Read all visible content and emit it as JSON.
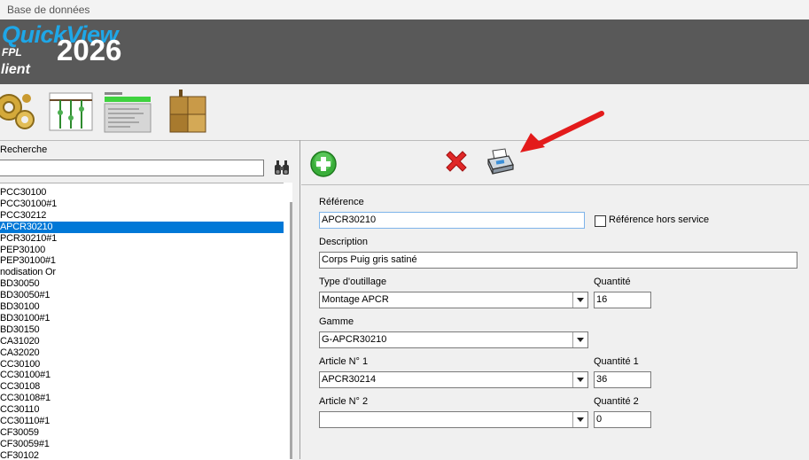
{
  "window": {
    "title": "Base de données"
  },
  "banner": {
    "brand": "QuickView",
    "sub": "FPL",
    "year": "2026",
    "client": "lient"
  },
  "toolbar": {
    "icons": [
      "gears-icon",
      "plants-icon",
      "program-list-icon",
      "boxes-icon"
    ]
  },
  "search": {
    "label": "Recherche",
    "value": ""
  },
  "references": [
    "PCC30100",
    "PCC30100#1",
    "PCC30212",
    "APCR30210",
    "PCR30210#1",
    "PEP30100",
    "PEP30100#1",
    "nodisation Or",
    "BD30050",
    "BD30050#1",
    "BD30100",
    "BD30100#1",
    "BD30150",
    "CA31020",
    "CA32020",
    "CC30100",
    "CC30100#1",
    "CC30108",
    "CC30108#1",
    "CC30110",
    "CC30110#1",
    "CF30059",
    "CF30059#1",
    "CF30102"
  ],
  "selected_reference": "APCR30210",
  "form": {
    "reference_label": "Référence",
    "reference_value": "APCR30210",
    "out_of_service_label": "Référence hors service",
    "out_of_service_checked": false,
    "description_label": "Description",
    "description_value": "Corps Puig gris satiné",
    "tooling_type_label": "Type d'outillage",
    "tooling_type_value": "Montage APCR",
    "quantity_label": "Quantité",
    "quantity_value": "16",
    "range_label": "Gamme",
    "range_value": "G-APCR30210",
    "article1_label": "Article N° 1",
    "article1_value": "APCR30214",
    "quantity1_label": "Quantité 1",
    "quantity1_value": "36",
    "article2_label": "Article N° 2",
    "article2_value": "",
    "quantity2_label": "Quantité 2",
    "quantity2_value": "0"
  },
  "colors": {
    "banner": "#595959",
    "brand": "#1ea7e8",
    "selection": "#0078d7",
    "arrow": "#e31b1b"
  }
}
